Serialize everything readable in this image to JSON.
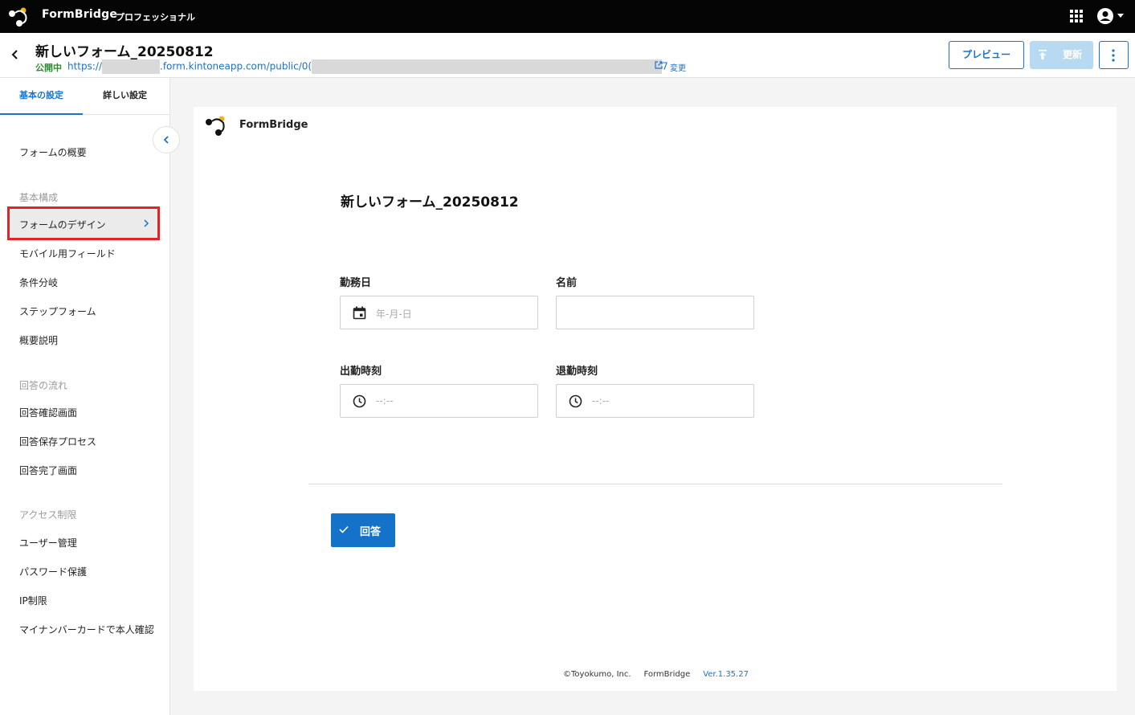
{
  "topbar": {
    "brand": "FormBridge",
    "plan": "プロフェッショナル",
    "logo_colors": [
      "#ffffff",
      "#f3b41b"
    ]
  },
  "header": {
    "title": "新しいフォーム_20250812",
    "status": "公開中",
    "url_prefix": "https://",
    "url_middle": ".form.kintoneapp.com/public/0(",
    "url_suffix": "7",
    "change_label": "変更",
    "preview_label": "プレビュー",
    "update_label": "更新"
  },
  "sidebar": {
    "tabs": [
      {
        "label": "基本の設定",
        "active": true
      },
      {
        "label": "詳しい設定",
        "active": false
      }
    ],
    "overview": "フォームの概要",
    "sections": [
      {
        "title": "基本構成",
        "items": [
          "フォームのデザイン",
          "モバイル用フィールド",
          "条件分岐",
          "ステップフォーム",
          "概要説明"
        ]
      },
      {
        "title": "回答の流れ",
        "items": [
          "回答確認画面",
          "回答保存プロセス",
          "回答完了画面"
        ]
      },
      {
        "title": "アクセス制限",
        "items": [
          "ユーザー管理",
          "パスワード保護",
          "IP制限",
          "マイナンバーカードで本人確認"
        ]
      }
    ],
    "selected_item": "フォームのデザイン"
  },
  "preview": {
    "brand": "FormBridge",
    "form_title": "新しいフォーム_20250812",
    "fields": [
      {
        "label": "勤務日",
        "placeholder": "年-月-日",
        "icon": "calendar-icon"
      },
      {
        "label": "名前",
        "placeholder": "",
        "icon": ""
      },
      {
        "label": "出勤時刻",
        "placeholder": "--:--",
        "icon": "clock-icon"
      },
      {
        "label": "退勤時刻",
        "placeholder": "--:--",
        "icon": "clock-icon"
      }
    ],
    "submit_label": "回答",
    "footer": {
      "copyright": "©Toyokumo, Inc.",
      "product": "FormBridge",
      "version": "Ver.1.35.27"
    }
  },
  "colors": {
    "accent": "#1a73c8",
    "status_green": "#2e8b2e",
    "highlight_red": "#e0242a",
    "logo_yellow": "#f3b41b"
  }
}
